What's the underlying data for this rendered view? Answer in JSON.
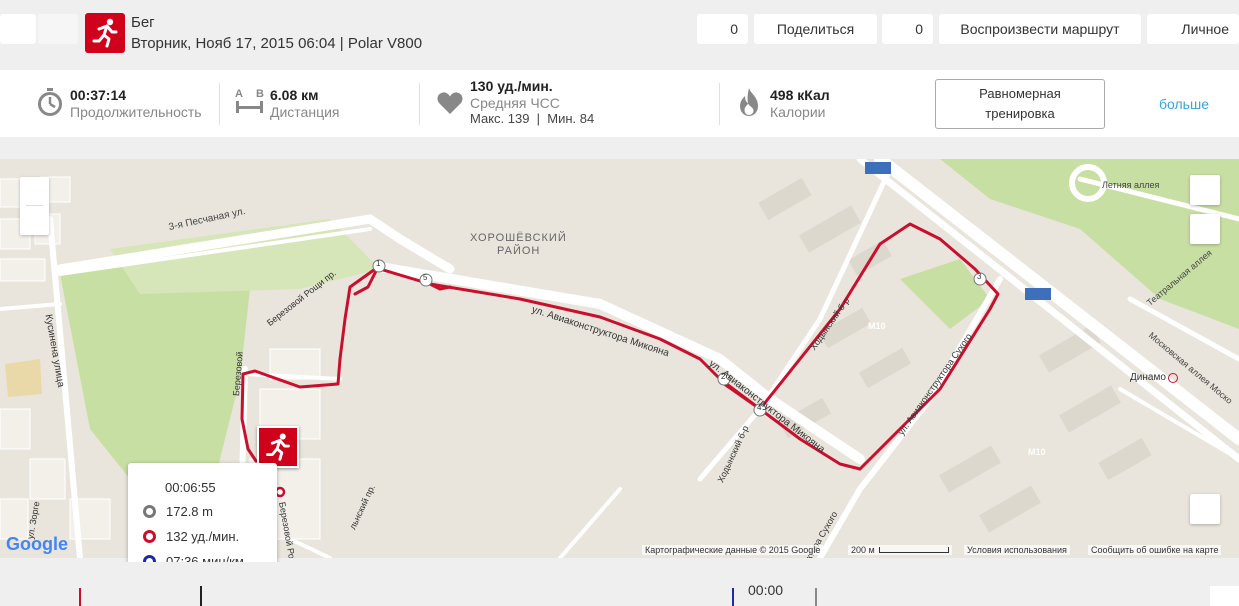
{
  "header": {
    "left_blank": "",
    "sport": "Бег",
    "session_info": "Вторник, Нояб 17, 2015 06:04 | Polar V800",
    "likes_count": "0",
    "share_label": "Поделиться",
    "share_count": "0",
    "replay_label": "Воспроизвести маршрут",
    "privacy_label": "Личное"
  },
  "stats": {
    "duration_value": "00:37:14",
    "duration_label": "Продолжительность",
    "distance_value": "6.08 км",
    "distance_label": "Дистанция",
    "distance_a": "A",
    "distance_b": "B",
    "hr_value": "130 уд./мин.",
    "hr_label": "Средняя ЧСС",
    "hr_maxmin": "Макс. 139  |  Мин. 84",
    "calories_value": "498 кКал",
    "calories_label": "Калории",
    "benefit_label": "Равномерная тренировка",
    "more_label": "больше"
  },
  "map": {
    "labels": {
      "district": "ХОРОШЁВСКИЙ",
      "district2": "РАЙОН",
      "street_pesch": "3-я Песчаная ул.",
      "street_mikoyan": "ул. Авиаконструктора Микояна",
      "street_mikoyan2": "ул. Авиаконструктора Микояна",
      "street_khod": "Ходынский б-р",
      "street_khod2": "Ходынский б-р",
      "street_sukh": "ул. Авиаконструктора Сухого",
      "street_sukh2": "ктора Сухого",
      "street_kus": "Кусинена улица",
      "street_berez": "Березовой Рощи пр.",
      "street_berez2": "Березовой",
      "street_berez3": "Березовой Рощ",
      "street_letn": "Летняя аллея",
      "street_teatr": "Театральная аллея",
      "street_mosk": "Московская аллея Моско",
      "street_zor": "ул. Зорге",
      "street_lnsk": "льнский пр.",
      "dinamo": "Динамо",
      "m10": "M10",
      "m10b": "M10",
      "km1": "1",
      "km2": "2",
      "km3": "3",
      "km4": "4",
      "km5": "5"
    },
    "google": "Google",
    "map_data": "Картографические данные © 2015 Google",
    "scale": "200 м",
    "terms": "Условия использования",
    "report": "Сообщить об ошибке на карте",
    "route_color": "#c8102e"
  },
  "tooltip": {
    "time": "00:06:55",
    "altitude": "172.8 m",
    "heart_rate": "132 уд./мин.",
    "pace": "07:36 мин/км"
  },
  "timeline": {
    "time_readout": "00:00"
  },
  "colors": {
    "brand_red": "#d0021b",
    "link_blue": "#3aa5d8",
    "pace_blue": "#1a2aa8"
  }
}
